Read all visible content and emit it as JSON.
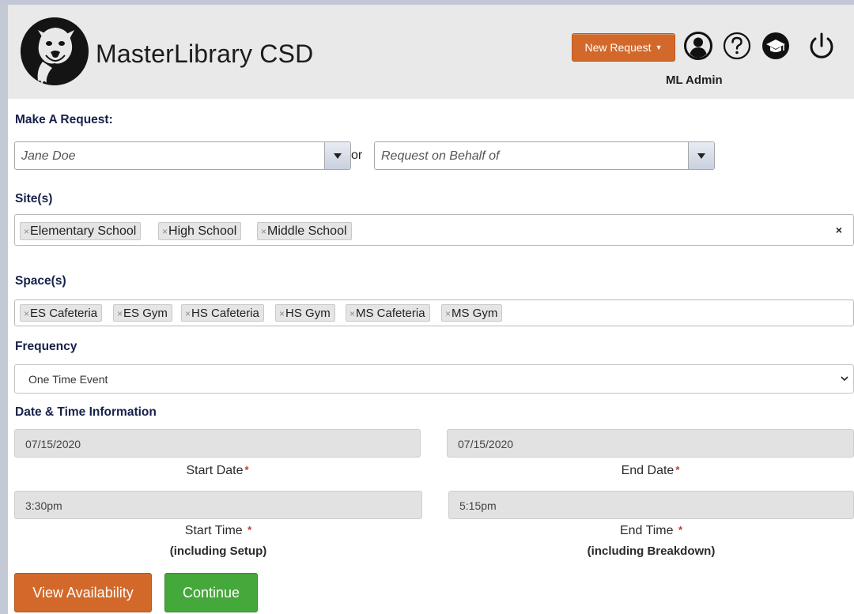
{
  "header": {
    "app_title": "MasterLibrary CSD",
    "new_request_label": "New Request",
    "user_label": "ML Admin",
    "icons": [
      "user-circle-icon",
      "help-icon",
      "graduation-cap-icon",
      "power-icon"
    ]
  },
  "request": {
    "section_label": "Make A Request:",
    "requester_value": "Jane Doe",
    "or_label": "or",
    "behalf_value": "Request on Behalf of"
  },
  "sites": {
    "label": "Site(s)",
    "tags": [
      "Elementary School",
      "High School",
      "Middle School"
    ],
    "clear_label": "×"
  },
  "spaces": {
    "label": "Space(s)",
    "tags": [
      "ES Cafeteria",
      "ES Gym",
      "HS Cafeteria",
      "HS Gym",
      "MS Cafeteria",
      "MS Gym"
    ]
  },
  "frequency": {
    "label": "Frequency",
    "selected": "One Time Event"
  },
  "datetime": {
    "label": "Date & Time Information",
    "start_date": "07/15/2020",
    "end_date": "07/15/2020",
    "start_date_label": "Start Date",
    "end_date_label": "End Date",
    "start_time": "3:30pm",
    "end_time": "5:15pm",
    "start_time_label": "Start Time",
    "end_time_label": "End Time",
    "start_time_note": "(including Setup)",
    "end_time_note": "(including Breakdown)",
    "required_mark": "*"
  },
  "actions": {
    "view_availability": "View Availability",
    "continue": "Continue"
  },
  "colors": {
    "accent_orange": "#d2692b",
    "success_green": "#45a83b",
    "label_navy": "#16204a"
  }
}
